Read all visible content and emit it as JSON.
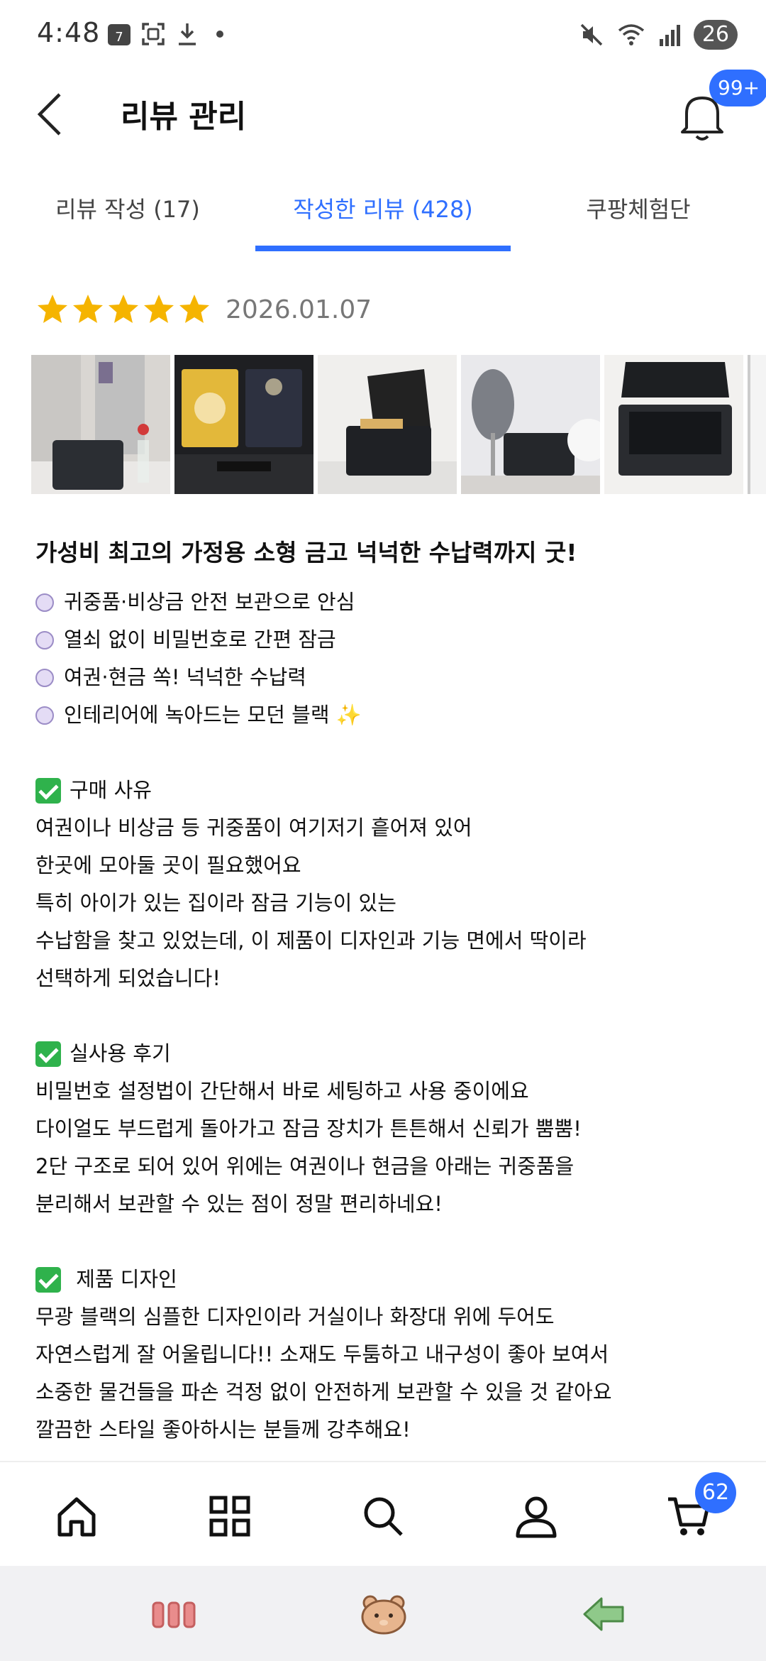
{
  "status_bar": {
    "time": "4:48",
    "calendar_icon_text": "7",
    "battery_level": "26"
  },
  "header": {
    "title": "리뷰 관리",
    "notification_badge": "99+"
  },
  "tabs": [
    {
      "label": "리뷰 작성 (17)",
      "active": false
    },
    {
      "label": "작성한 리뷰 (428)",
      "active": true
    },
    {
      "label": "쿠팡체험단",
      "active": false
    }
  ],
  "review": {
    "rating": 5,
    "date": "2026.01.07",
    "title": "가성비 최고의 가정용 소형 금고 넉넉한 수납력까지 굿!",
    "bullets": [
      "귀중품·비상금 안전 보관으로 안심",
      "열쇠 없이 비밀번호로 간편 잠금",
      "여권·현금 쏙! 넉넉한 수납력",
      "인테리어에 녹아드는 모던 블랙 ✨"
    ],
    "sections": [
      {
        "heading": "구매 사유",
        "lines": [
          "여권이나 비상금 등 귀중품이 여기저기 흩어져 있어",
          "한곳에 모아둘 곳이 필요했어요",
          "특히 아이가 있는 집이라 잠금 기능이 있는",
          "수납함을 찾고 있었는데, 이 제품이 디자인과 기능 면에서 딱이라",
          "선택하게 되었습니다!"
        ]
      },
      {
        "heading": "실사용 후기",
        "lines": [
          "비밀번호 설정법이 간단해서 바로 세팅하고 사용 중이에요",
          "다이얼도 부드럽게 돌아가고 잠금 장치가 튼튼해서 신뢰가 뿜뿜!",
          "2단 구조로 되어 있어 위에는 여권이나 현금을 아래는 귀중품을",
          "분리해서 보관할 수 있는 점이 정말 편리하네요!"
        ]
      },
      {
        "heading": " 제품 디자인",
        "lines": [
          "무광 블랙의 심플한 디자인이라 거실이나 화장대 위에 두어도",
          "자연스럽게 잘 어울립니다!! 소재도 두툼하고 내구성이 좋아 보여서",
          "소중한 물건들을 파손 걱정 없이 안전하게 보관할 수 있을 것 같아요",
          "깔끔한 스타일 좋아하시는 분들께 강추해요!"
        ]
      }
    ]
  },
  "bottom_nav": {
    "items": [
      "home-icon",
      "categories-icon",
      "search-icon",
      "profile-icon",
      "cart-icon"
    ],
    "cart_badge": "62"
  },
  "colors": {
    "accent": "#2f6fff",
    "star": "#f5b400",
    "check": "#2fb24c"
  }
}
